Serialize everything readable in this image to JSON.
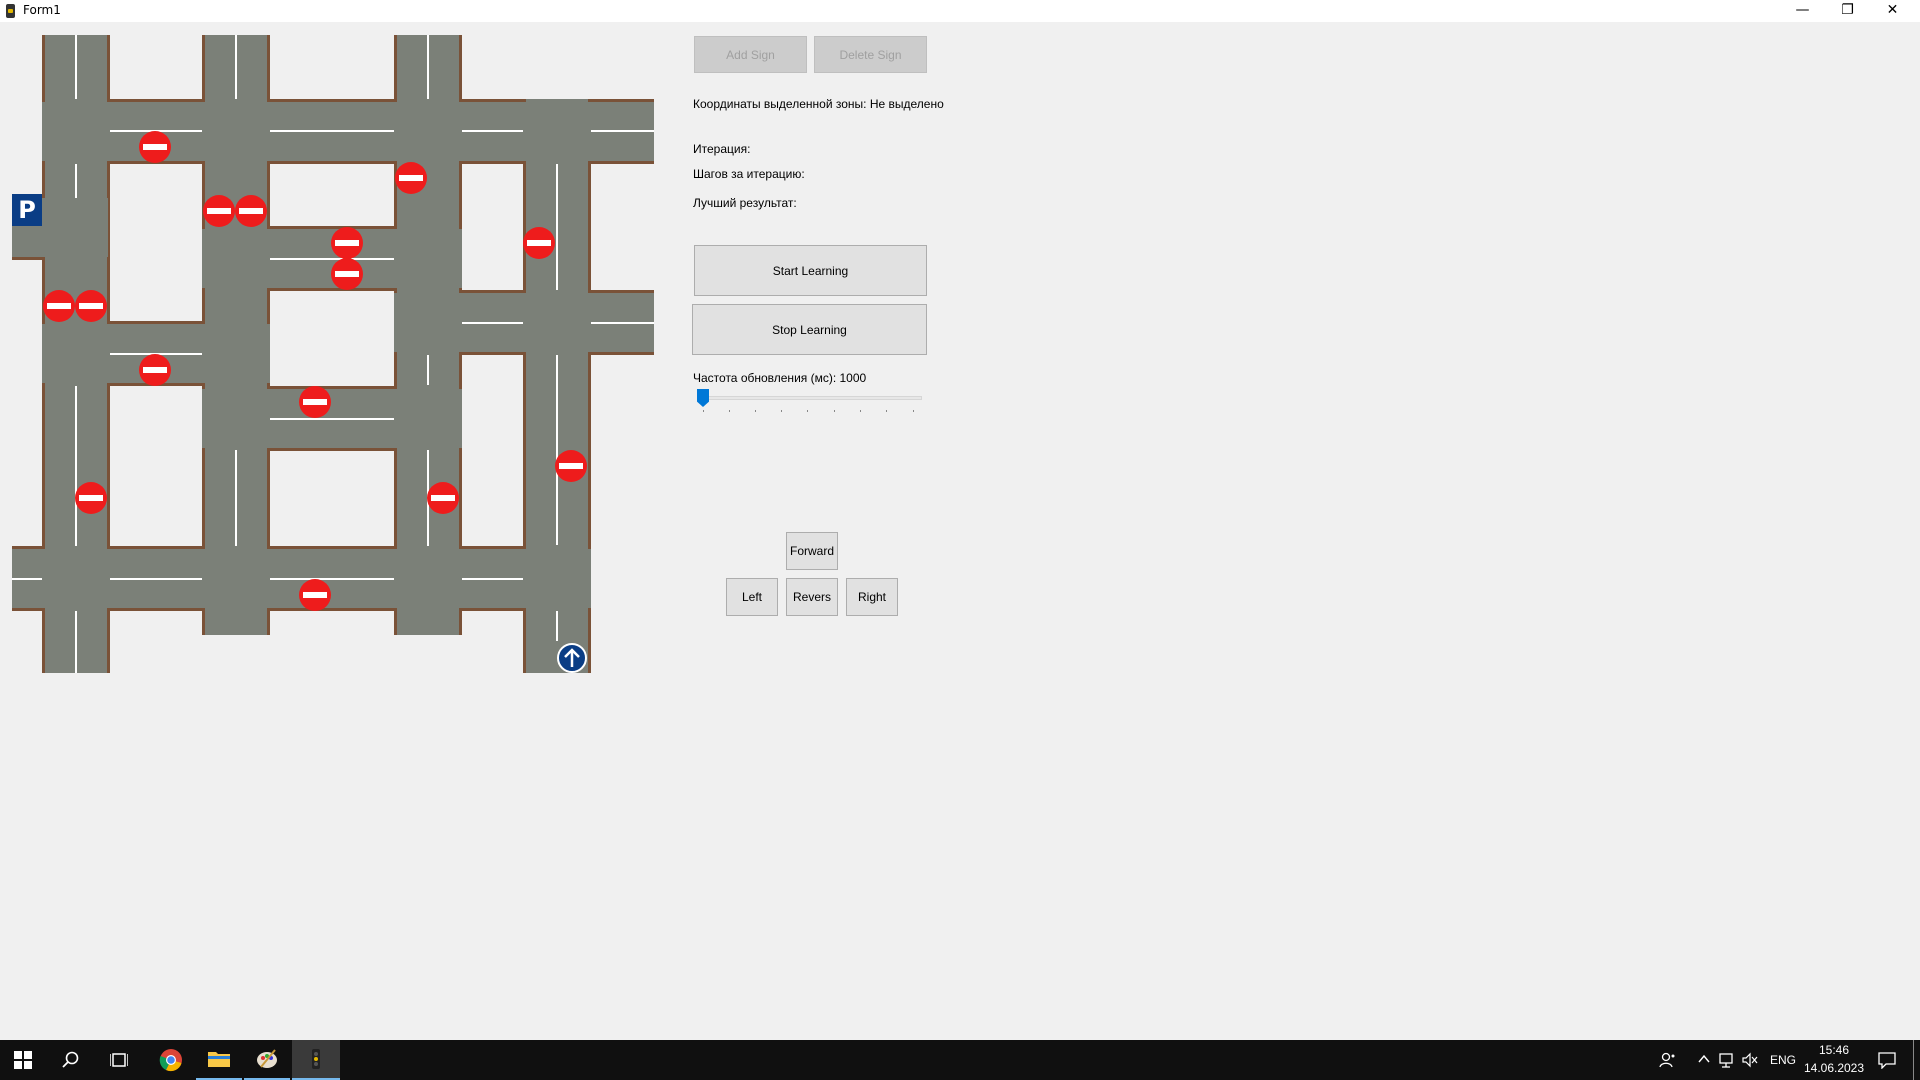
{
  "window": {
    "title": "Form1",
    "minimize_glyph": "—",
    "restore_glyph": "❐",
    "close_glyph": "✕"
  },
  "map": {
    "parking_label": "P",
    "road_color": "#7b8078",
    "curb_color": "#7a5238",
    "sign_color": "#ee1c1c",
    "parking_color": "#0a3d85"
  },
  "controls": {
    "add_sign": "Add Sign",
    "delete_sign": "Delete Sign",
    "zone_coords": "Координаты выделенной зоны: Не выделено",
    "iteration": "Итерация:",
    "steps_per_iteration": "Шагов за итерацию:",
    "best_result": "Лучший результат:",
    "start_learning": "Start Learning",
    "stop_learning": "Stop Learning",
    "update_freq": "Частота обновления (мс): 1000",
    "slider_value": 1000,
    "forward": "Forward",
    "left": "Left",
    "revers": "Revers",
    "right": "Right"
  },
  "taskbar": {
    "icons": [
      "windows-start-icon",
      "search-icon",
      "task-view-icon",
      "chrome-icon",
      "file-explorer-icon",
      "paint-app-icon",
      "traffic-light-app-icon"
    ],
    "language": "ENG",
    "time": "15:46",
    "date": "14.06.2023"
  }
}
